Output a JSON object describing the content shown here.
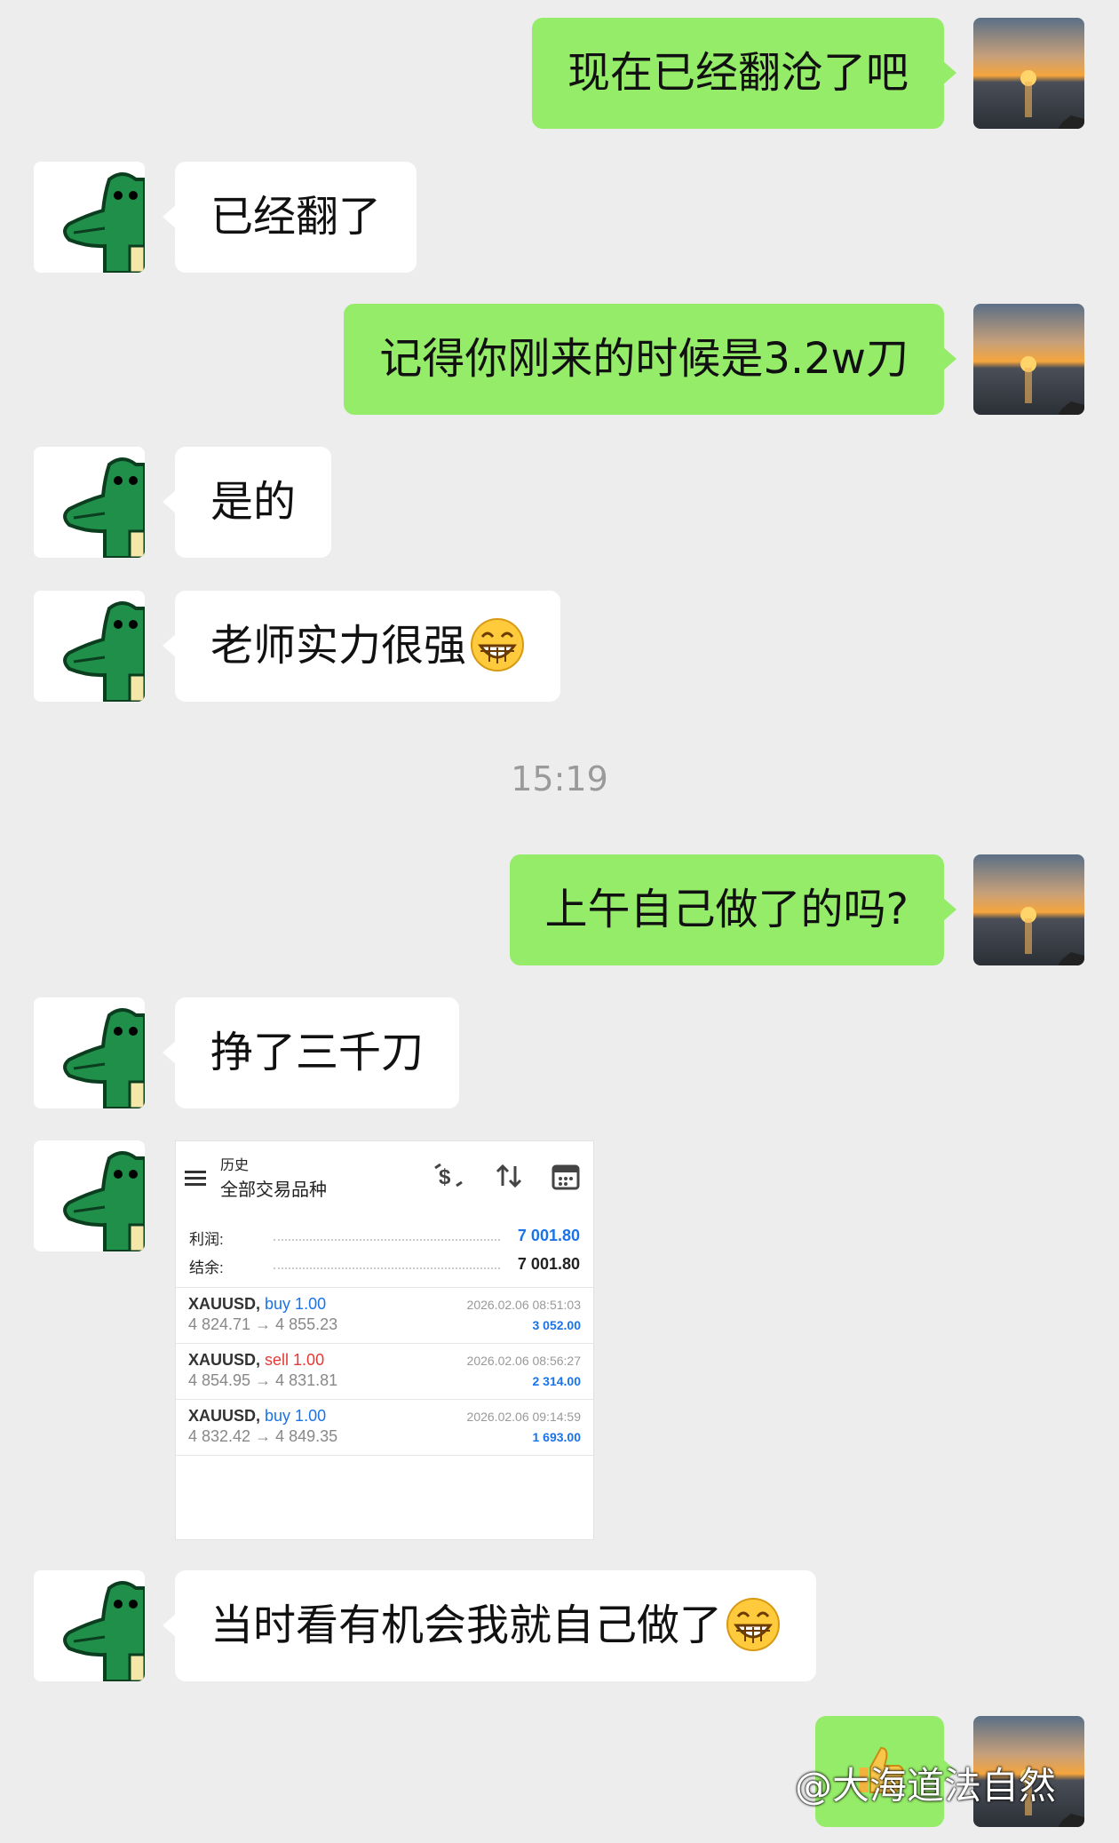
{
  "messages": {
    "m1": "现在已经翻沧了吧",
    "m2": "已经翻了",
    "m3": "记得你刚来的时候是3.2w刀",
    "m4": "是的",
    "m5": "老师实力很强",
    "time": "15:19",
    "m6": "上午自己做了的吗?",
    "m7": "挣了三千刀",
    "m8": "当时看有机会我就自己做了"
  },
  "trade_screenshot": {
    "header_small": "历史",
    "header_big": "全部交易品种",
    "profit_label": "利润:",
    "profit_value": "7 001.80",
    "balance_label": "结余:",
    "balance_value": "7 001.80",
    "trades": [
      {
        "symbol": "XAUUSD,",
        "side": "buy 1.00",
        "prices": "4 824.71 → 4 855.23",
        "datetime": "2026.02.06 08:51:03",
        "profit": "3 052.00"
      },
      {
        "symbol": "XAUUSD,",
        "side": "sell 1.00",
        "prices": "4 854.95 → 4 831.81",
        "datetime": "2026.02.06 08:56:27",
        "profit": "2 314.00"
      },
      {
        "symbol": "XAUUSD,",
        "side": "buy 1.00",
        "prices": "4 832.42 → 4 849.35",
        "datetime": "2026.02.06 09:14:59",
        "profit": "1 693.00"
      }
    ],
    "icons": [
      "menu-icon",
      "dollar-exchange-icon",
      "sort-icon",
      "calendar-icon"
    ]
  },
  "watermark": "@大海道法自然",
  "colors": {
    "me_bubble": "#95ec69",
    "them_bubble": "#ffffff",
    "background": "#ededed"
  }
}
